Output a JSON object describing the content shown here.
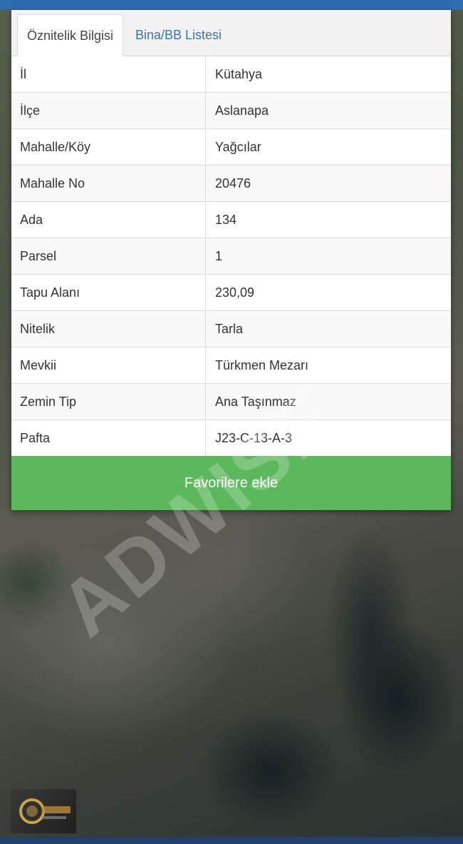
{
  "tabs": {
    "active_label": "Öznitelik Bilgisi",
    "inactive_label": "Bina/BB Listesi"
  },
  "rows": [
    {
      "label": "İl",
      "value": "Kütahya"
    },
    {
      "label": "İlçe",
      "value": "Aslanapa"
    },
    {
      "label": "Mahalle/Köy",
      "value": "Yağcılar"
    },
    {
      "label": "Mahalle No",
      "value": "20476"
    },
    {
      "label": "Ada",
      "value": "134"
    },
    {
      "label": "Parsel",
      "value": "1"
    },
    {
      "label": "Tapu Alanı",
      "value": "230,09"
    },
    {
      "label": "Nitelik",
      "value": "Tarla"
    },
    {
      "label": "Mevkii",
      "value": "Türkmen Mezarı"
    },
    {
      "label": "Zemin Tip",
      "value": "Ana Taşınmaz"
    },
    {
      "label": "Pafta",
      "value": "J23-C-13-A-3"
    }
  ],
  "button": {
    "favorite_label": "Favorilere ekle"
  },
  "watermark": "ADWISE",
  "colors": {
    "button_green": "#5cb85c",
    "tab_link_blue": "#3b74b0",
    "top_bar_blue": "#2f6db1"
  }
}
